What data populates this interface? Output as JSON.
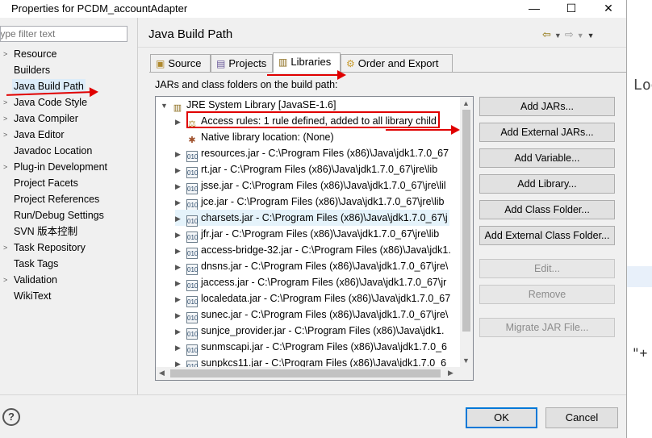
{
  "window": {
    "title": "Properties for PCDM_accountAdapter",
    "controls": {
      "minimize": "—",
      "maximize": "☐",
      "close": "✕"
    }
  },
  "background": {
    "text_top": "Log",
    "text_bottom": "\"+"
  },
  "filter": {
    "placeholder": "type filter text"
  },
  "nav": {
    "items": [
      {
        "label": "Resource",
        "expandable": true
      },
      {
        "label": "Builders",
        "expandable": false
      },
      {
        "label": "Java Build Path",
        "expandable": false,
        "selected": true
      },
      {
        "label": "Java Code Style",
        "expandable": true
      },
      {
        "label": "Java Compiler",
        "expandable": true
      },
      {
        "label": "Java Editor",
        "expandable": true
      },
      {
        "label": "Javadoc Location",
        "expandable": false
      },
      {
        "label": "Plug-in Development",
        "expandable": true
      },
      {
        "label": "Project Facets",
        "expandable": false
      },
      {
        "label": "Project References",
        "expandable": false
      },
      {
        "label": "Run/Debug Settings",
        "expandable": false
      },
      {
        "label": "SVN 版本控制",
        "expandable": false
      },
      {
        "label": "Task Repository",
        "expandable": true
      },
      {
        "label": "Task Tags",
        "expandable": false
      },
      {
        "label": "Validation",
        "expandable": true
      },
      {
        "label": "WikiText",
        "expandable": false
      }
    ]
  },
  "page": {
    "title": "Java Build Path"
  },
  "tabs": [
    {
      "label": "Source",
      "active": false
    },
    {
      "label": "Projects",
      "active": false
    },
    {
      "label": "Libraries",
      "active": true
    },
    {
      "label": "Order and Export",
      "active": false
    }
  ],
  "libraries": {
    "section_label": "JARs and class folders on the build path:",
    "root": "JRE System Library [JavaSE-1.6]",
    "access_rules": "Access rules: 1 rule defined, added to all library child",
    "native_library": "Native library location: (None)",
    "jars": [
      "resources.jar - C:\\Program Files (x86)\\Java\\jdk1.7.0_67",
      "rt.jar - C:\\Program Files (x86)\\Java\\jdk1.7.0_67\\jre\\lib",
      "jsse.jar - C:\\Program Files (x86)\\Java\\jdk1.7.0_67\\jre\\lil",
      "jce.jar - C:\\Program Files (x86)\\Java\\jdk1.7.0_67\\jre\\lib",
      "charsets.jar - C:\\Program Files (x86)\\Java\\jdk1.7.0_67\\j",
      "jfr.jar - C:\\Program Files (x86)\\Java\\jdk1.7.0_67\\jre\\lib",
      "access-bridge-32.jar - C:\\Program Files (x86)\\Java\\jdk1.",
      "dnsns.jar - C:\\Program Files (x86)\\Java\\jdk1.7.0_67\\jre\\",
      "jaccess.jar - C:\\Program Files (x86)\\Java\\jdk1.7.0_67\\jr",
      "localedata.jar - C:\\Program Files (x86)\\Java\\jdk1.7.0_67",
      "sunec.jar - C:\\Program Files (x86)\\Java\\jdk1.7.0_67\\jre\\",
      "sunjce_provider.jar - C:\\Program Files (x86)\\Java\\jdk1.",
      "sunmscapi.jar - C:\\Program Files (x86)\\Java\\jdk1.7.0_6",
      "sunpkcs11.jar - C:\\Program Files (x86)\\Java\\jdk1.7.0_6"
    ]
  },
  "buttons": {
    "add_jars": "Add JARs...",
    "add_external_jars": "Add External JARs...",
    "add_variable": "Add Variable...",
    "add_library": "Add Library...",
    "add_class_folder": "Add Class Folder...",
    "add_external_class_folder": "Add External Class Folder...",
    "edit": "Edit...",
    "remove": "Remove",
    "migrate_jar": "Migrate JAR File..."
  },
  "footer": {
    "help": "?",
    "ok": "OK",
    "cancel": "Cancel"
  },
  "colors": {
    "annotation_red": "#e00000",
    "selection": "#dcecf9",
    "focus_blue": "#0078d7"
  }
}
